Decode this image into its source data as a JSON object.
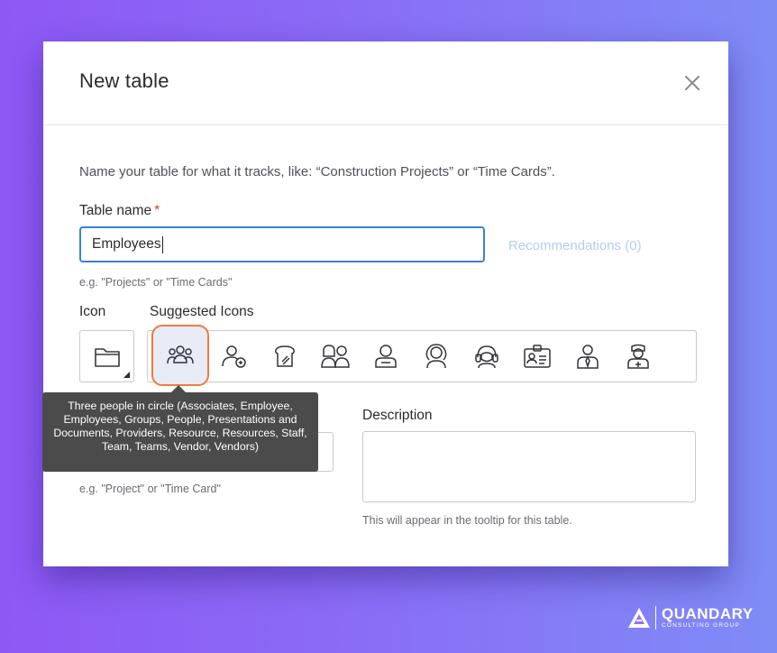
{
  "dialog": {
    "title": "New table",
    "intro": "Name your table for what it tracks, like: “Construction Projects” or “Time Cards”."
  },
  "table_name": {
    "label": "Table name",
    "required_mark": "*",
    "value": "Employees",
    "recommendations": "Recommendations (0)",
    "hint": "e.g. \"Projects\" or \"Time Cards\""
  },
  "icon_section": {
    "icon_label": "Icon",
    "suggested_label": "Suggested Icons",
    "current_icon": "folder-icon",
    "suggested_icons": [
      {
        "name": "three-people-circle-icon",
        "selected": true
      },
      {
        "name": "person-add-icon",
        "selected": false
      },
      {
        "name": "bread-icon",
        "selected": false
      },
      {
        "name": "two-people-icon",
        "selected": false
      },
      {
        "name": "person-icon",
        "selected": false
      },
      {
        "name": "woman-icon",
        "selected": false
      },
      {
        "name": "person-headset-icon",
        "selected": false
      },
      {
        "name": "id-badge-icon",
        "selected": false
      },
      {
        "name": "person-tie-icon",
        "selected": false
      },
      {
        "name": "nurse-icon",
        "selected": false
      }
    ],
    "tooltip": "Three people in circle (Associates, Employee, Employees, Groups, People, Presentations and Documents, Providers, Resource, Resources, Staff, Team, Teams, Vendor, Vendors)"
  },
  "singular": {
    "value": "",
    "hint": "e.g. \"Project\" or \"Time Card\""
  },
  "description": {
    "label": "Description",
    "value": "",
    "hint": "This will appear in the tooltip for this table."
  },
  "brand": {
    "name": "QUANDARY",
    "subtitle": "CONSULTING GROUP"
  },
  "colors": {
    "accent": "#3d7fd6",
    "selection_ring": "#f07a3c",
    "required": "#d0413a",
    "background_start": "#8e58f5",
    "background_end": "#7f8cf6"
  }
}
